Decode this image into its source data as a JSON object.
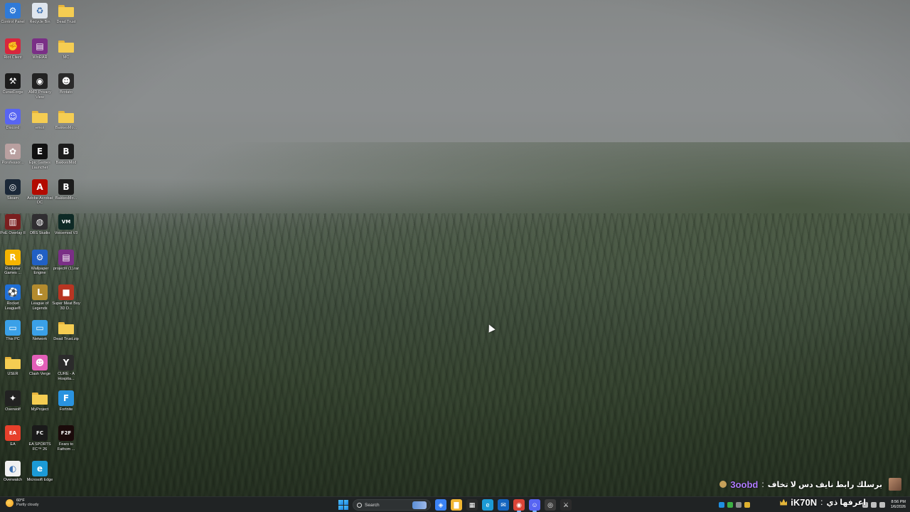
{
  "desktop": {
    "icons": [
      {
        "label": "Control Panel",
        "icon": "control-panel-icon",
        "color": "#2f7ad8",
        "glyph": "⚙"
      },
      {
        "label": "Recycle Bin",
        "icon": "recycle-bin-icon",
        "color": "#dfe6ee",
        "glyph": "♻"
      },
      {
        "label": "Dead Trust",
        "icon": "folder-icon",
        "folder": true
      },
      {
        "label": "Riot Client",
        "icon": "riot-client-icon",
        "color": "#d7263d",
        "glyph": "✊"
      },
      {
        "label": "WinRAR",
        "icon": "winrar-icon",
        "color": "#7a2f86",
        "glyph": "▤"
      },
      {
        "label": "MC",
        "icon": "folder-icon",
        "folder": true
      },
      {
        "label": "CurseForge",
        "icon": "curseforge-icon",
        "color": "#1b1b1b",
        "glyph": "⚒"
      },
      {
        "label": "AMD Privacy View",
        "icon": "amd-privacy-view-icon",
        "color": "#222222",
        "glyph": "◉"
      },
      {
        "label": "Brotato",
        "icon": "brotato-icon",
        "color": "#2a2a2a",
        "glyph": "☻"
      },
      {
        "label": "Discord",
        "icon": "discord-icon",
        "color": "#5865f2",
        "glyph": "☺"
      },
      {
        "label": "emot",
        "icon": "folder-icon",
        "folder": true
      },
      {
        "label": "BakkesMo...",
        "icon": "folder-icon",
        "folder": true
      },
      {
        "label": "Porofessor...",
        "icon": "porofessor-icon",
        "color": "#b9a0a0",
        "glyph": "✿"
      },
      {
        "label": "Epic Games Launcher",
        "icon": "epic-games-icon",
        "color": "#111111",
        "glyph": "E"
      },
      {
        "label": "BakkesMod",
        "icon": "bakkesmod-icon",
        "color": "#1c1c1c",
        "glyph": "B"
      },
      {
        "label": "Steam",
        "icon": "steam-icon",
        "color": "#1b2838",
        "glyph": "◎"
      },
      {
        "label": "Adobe Acrobat DC",
        "icon": "adobe-acrobat-icon",
        "color": "#b30b00",
        "glyph": "A"
      },
      {
        "label": "BakkesMo...",
        "icon": "bakkesmod-icon",
        "color": "#1c1c1c",
        "glyph": "B"
      },
      {
        "label": "PoE Overlay II",
        "icon": "poe-overlay-icon",
        "color": "#7a1f1f",
        "glyph": "▥"
      },
      {
        "label": "OBS Studio",
        "icon": "obs-studio-icon",
        "color": "#302e31",
        "glyph": "◍"
      },
      {
        "label": "Voicemod V3",
        "icon": "voicemod-icon",
        "color": "#0e2a26",
        "glyph": "VM"
      },
      {
        "label": "Rockstar Games ...",
        "icon": "rockstar-games-icon",
        "color": "#f5b400",
        "glyph": "R"
      },
      {
        "label": "Wallpaper Engine",
        "icon": "wallpaper-engine-icon",
        "color": "#2160c4",
        "glyph": "⚙"
      },
      {
        "label": "project# (1).rar",
        "icon": "winrar-archive-icon",
        "color": "#7a2f86",
        "glyph": "▤"
      },
      {
        "label": "Rocket League®",
        "icon": "rocket-league-icon",
        "color": "#1f6fd6",
        "glyph": "⚽"
      },
      {
        "label": "League of Legends",
        "icon": "league-of-legends-icon",
        "color": "#b38b2e",
        "glyph": "L"
      },
      {
        "label": "Super Meat Boy 3D D...",
        "icon": "super-meat-boy-icon",
        "color": "#b83522",
        "glyph": "■"
      },
      {
        "label": "This PC",
        "icon": "this-pc-icon",
        "color": "#3aa0e8",
        "glyph": "▭"
      },
      {
        "label": "Network",
        "icon": "network-icon",
        "color": "#3aa0e8",
        "glyph": "▭"
      },
      {
        "label": "Dead Trust.zip",
        "icon": "zip-folder-icon",
        "folder": true
      },
      {
        "label": "USER",
        "icon": "folder-icon",
        "folder": true
      },
      {
        "label": "Clash Verge",
        "icon": "clash-verge-icon",
        "color": "#e35fb8",
        "glyph": "☻"
      },
      {
        "label": "CURE - A Hospita...",
        "icon": "cure-game-icon",
        "color": "#2b2b2b",
        "glyph": "Y"
      },
      {
        "label": "Overwolf",
        "icon": "overwolf-icon",
        "color": "#222222",
        "glyph": "✦"
      },
      {
        "label": "MyProject",
        "icon": "folder-icon",
        "folder": true
      },
      {
        "label": "Fortnite",
        "icon": "fortnite-icon",
        "color": "#2a93e0",
        "glyph": "F"
      },
      {
        "label": "EA",
        "icon": "ea-icon",
        "color": "#e7402b",
        "glyph": "EA"
      },
      {
        "label": "EA SPORTS FC™ 26",
        "icon": "ea-sports-fc-icon",
        "color": "#1a1a1a",
        "glyph": "FC"
      },
      {
        "label": "Fears to Fathom ...",
        "icon": "fears-to-fathom-icon",
        "color": "#1a0a0a",
        "glyph": "F2F"
      },
      {
        "label": "Overwatch",
        "icon": "overwatch-icon",
        "color": "#f0f0f0",
        "glyph": "◐"
      },
      {
        "label": "Microsoft Edge",
        "icon": "microsoft-edge-icon",
        "color": "#1c9ad6",
        "glyph": "e"
      }
    ]
  },
  "chat": {
    "username": "3oobd",
    "separator": ":",
    "message": "برسلك رابط نايف دس لا تخاف"
  },
  "stream_tag": {
    "name": "iK70N",
    "separator": ":",
    "message": "اعرفها ذي"
  },
  "taskbar": {
    "weather": {
      "temp": "60°F",
      "condition": "Partly cloudy"
    },
    "search_label": "Search",
    "apps": [
      {
        "name": "copilot-app-icon",
        "color": "#3b82f6",
        "glyph": "◈"
      },
      {
        "name": "file-explorer-app-icon",
        "color": "#f2b632",
        "glyph": "▇"
      },
      {
        "name": "microsoft-store-app-icon",
        "color": "#2b2b2b",
        "glyph": "▦"
      },
      {
        "name": "edge-app-icon",
        "color": "#1c9ad6",
        "glyph": "e"
      },
      {
        "name": "outlook-app-icon",
        "color": "#1565c0",
        "glyph": "✉"
      },
      {
        "name": "chrome-app-icon",
        "color": "#db4437",
        "glyph": "◉",
        "active": true
      },
      {
        "name": "discord-app-icon",
        "color": "#5865f2",
        "glyph": "☺",
        "active": true
      },
      {
        "name": "riot-app-icon",
        "color": "#3a3a3a",
        "glyph": "◎"
      },
      {
        "name": "sword-app-icon",
        "color": "#2b2b2b",
        "glyph": "⚔"
      }
    ],
    "tray": {
      "time": "8:56 PM",
      "date": "1/6/2026"
    }
  }
}
